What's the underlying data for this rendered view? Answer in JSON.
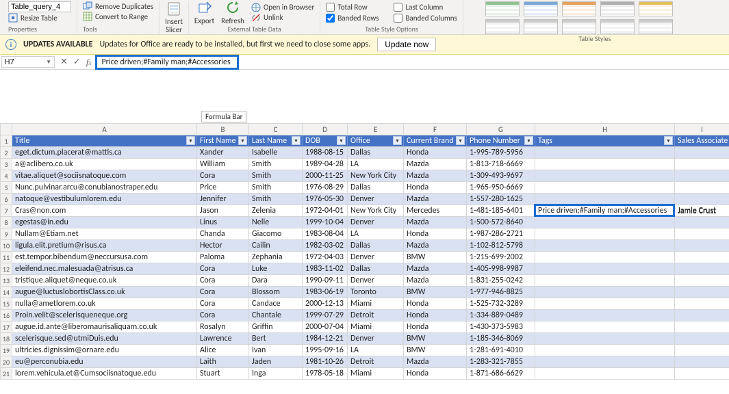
{
  "ribbon": {
    "table_name_value": "Table_query_4",
    "resize_table": "Resize Table",
    "properties_label": "Properties",
    "remove_duplicates": "Remove Duplicates",
    "convert_to_range": "Convert to Range",
    "tools_label": "Tools",
    "insert_slicer": "Insert\nSlicer",
    "export": "Export",
    "refresh": "Refresh",
    "open_in_browser": "Open in Browser",
    "unlink": "Unlink",
    "external_table_data_label": "External Table Data",
    "total_row": "Total Row",
    "last_column": "Last Column",
    "banded_rows": "Banded Rows",
    "banded_columns": "Banded Columns",
    "table_style_options_label": "Table Style Options",
    "table_styles_label": "Table Styles"
  },
  "updates": {
    "title": "UPDATES AVAILABLE",
    "message": "Updates for Office are ready to be installed, but first we need to close some apps.",
    "button": "Update now"
  },
  "formula": {
    "namebox": "H7",
    "value": "Price driven;#Family man;#Accessories",
    "tooltip": "Formula Bar"
  },
  "sheet": {
    "col_letters": [
      "A",
      "B",
      "C",
      "D",
      "E",
      "F",
      "G",
      "H",
      "I"
    ],
    "headers": [
      "Title",
      "First Name",
      "Last Name",
      "DOB",
      "Office",
      "Current Brand",
      "Phone Number",
      "Tags",
      "Sales Associate"
    ],
    "rows": [
      {
        "n": 2,
        "c": [
          "eget.dictum.placerat@mattis.ca",
          "Xander",
          "Isabelle",
          "1988-08-15",
          "Dallas",
          "Honda",
          "1-995-789-5956",
          "",
          ""
        ]
      },
      {
        "n": 3,
        "c": [
          "a@aclibero.co.uk",
          "William",
          "Smith",
          "1989-04-28",
          "LA",
          "Mazda",
          "1-813-718-6669",
          "",
          ""
        ]
      },
      {
        "n": 4,
        "c": [
          "vitae.aliquet@sociisnatoque.com",
          "Cora",
          "Smith",
          "2000-11-25",
          "New York City",
          "Mazda",
          "1-309-493-9697",
          "",
          ""
        ]
      },
      {
        "n": 5,
        "c": [
          "Nunc.pulvinar.arcu@conubianostraper.edu",
          "Price",
          "Smith",
          "1976-08-29",
          "Dallas",
          "Honda",
          "1-965-950-6669",
          "",
          ""
        ]
      },
      {
        "n": 6,
        "c": [
          "natoque@vestibulumlorem.edu",
          "Jennifer",
          "Smith",
          "1976-05-30",
          "Denver",
          "Mazda",
          "1-557-280-1625",
          "",
          ""
        ]
      },
      {
        "n": 7,
        "c": [
          "Cras@non.com",
          "Jason",
          "Zelenia",
          "1972-04-01",
          "New York City",
          "Mercedes",
          "1-481-185-6401",
          "Price driven;#Family man;#Accessories",
          "Jamie Crust"
        ]
      },
      {
        "n": 8,
        "c": [
          "egestas@in.edu",
          "Linus",
          "Nelle",
          "1999-10-04",
          "Denver",
          "Mazda",
          "1-500-572-8640",
          "",
          ""
        ]
      },
      {
        "n": 9,
        "c": [
          "Nullam@Etiam.net",
          "Chanda",
          "Giacomo",
          "1983-08-04",
          "LA",
          "Honda",
          "1-987-286-2721",
          "",
          ""
        ]
      },
      {
        "n": 10,
        "c": [
          "ligula.elit.pretium@risus.ca",
          "Hector",
          "Cailin",
          "1982-03-02",
          "Dallas",
          "Mazda",
          "1-102-812-5798",
          "",
          ""
        ]
      },
      {
        "n": 11,
        "c": [
          "est.tempor.bibendum@neccursusa.com",
          "Paloma",
          "Zephania",
          "1972-04-03",
          "Denver",
          "BMW",
          "1-215-699-2002",
          "",
          ""
        ]
      },
      {
        "n": 12,
        "c": [
          "eleifend.nec.malesuada@atrisus.ca",
          "Cora",
          "Luke",
          "1983-11-02",
          "Dallas",
          "Mazda",
          "1-405-998-9987",
          "",
          ""
        ]
      },
      {
        "n": 13,
        "c": [
          "tristique.aliquet@neque.co.uk",
          "Cora",
          "Dara",
          "1990-09-11",
          "Denver",
          "Mazda",
          "1-831-255-0242",
          "",
          ""
        ]
      },
      {
        "n": 14,
        "c": [
          "augue@luctuslobortisClass.co.uk",
          "Cora",
          "Blossom",
          "1983-06-19",
          "Toronto",
          "BMW",
          "1-977-946-8825",
          "",
          ""
        ]
      },
      {
        "n": 15,
        "c": [
          "nulla@ametlorem.co.uk",
          "Cora",
          "Candace",
          "2000-12-13",
          "Miami",
          "Honda",
          "1-525-732-3289",
          "",
          ""
        ]
      },
      {
        "n": 16,
        "c": [
          "Proin.velit@scelerisqueneque.org",
          "Cora",
          "Chantale",
          "1999-07-29",
          "Detroit",
          "Honda",
          "1-334-889-0489",
          "",
          ""
        ]
      },
      {
        "n": 17,
        "c": [
          "augue.id.ante@liberomaurisaliquam.co.uk",
          "Rosalyn",
          "Griffin",
          "2000-07-04",
          "Miami",
          "Honda",
          "1-430-373-5983",
          "",
          ""
        ]
      },
      {
        "n": 18,
        "c": [
          "scelerisque.sed@utmiDuis.edu",
          "Lawrence",
          "Bert",
          "1984-12-21",
          "Denver",
          "BMW",
          "1-185-346-8069",
          "",
          ""
        ]
      },
      {
        "n": 19,
        "c": [
          "ultricies.dignissim@ornare.edu",
          "Alice",
          "Ivan",
          "1995-09-16",
          "LA",
          "BMW",
          "1-281-691-4010",
          "",
          ""
        ]
      },
      {
        "n": 20,
        "c": [
          "eu@perconubia.edu",
          "Laith",
          "Jaden",
          "1981-10-26",
          "Detroit",
          "Mazda",
          "1-283-321-7855",
          "",
          ""
        ]
      },
      {
        "n": 21,
        "c": [
          "lorem.vehicula.et@Cumsociisnatoque.edu",
          "Stuart",
          "Inga",
          "1978-05-18",
          "Miami",
          "Honda",
          "1-871-686-6629",
          "",
          ""
        ]
      }
    ]
  },
  "active_cell": {
    "row_index": 5,
    "col_index": 7
  }
}
